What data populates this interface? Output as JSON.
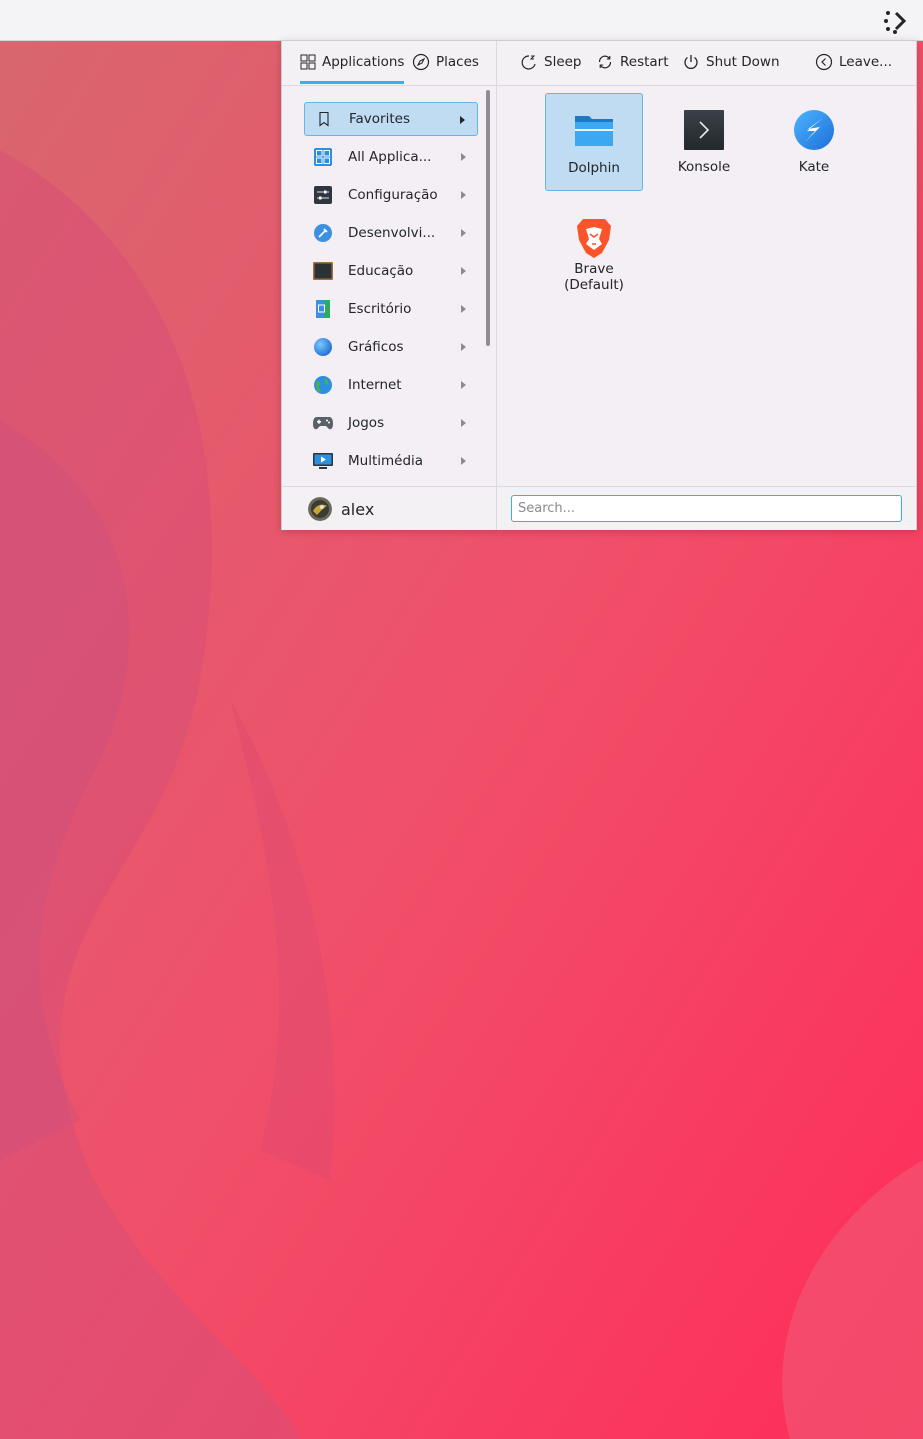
{
  "colors": {
    "accent": "#3daee9",
    "selection_bg": "#bfdcf2",
    "wallpaper_base": "#f2586d"
  },
  "header": {
    "tabs": [
      {
        "label": "Applications",
        "icon": "grid-icon",
        "active": true
      },
      {
        "label": "Places",
        "icon": "compass-icon",
        "active": false
      }
    ],
    "power": [
      {
        "label": "Sleep",
        "icon": "sleep-icon"
      },
      {
        "label": "Restart",
        "icon": "restart-icon"
      },
      {
        "label": "Shut Down",
        "icon": "power-icon"
      },
      {
        "label": "Leave...",
        "icon": "leave-icon"
      }
    ]
  },
  "categories": [
    {
      "label": "Favorites",
      "icon": "bookmark-icon",
      "selected": true
    },
    {
      "label": "All Applica...",
      "icon": "all-apps-icon"
    },
    {
      "label": "Configuração",
      "icon": "settings-icon"
    },
    {
      "label": "Desenvolvi...",
      "icon": "development-icon"
    },
    {
      "label": "Educação",
      "icon": "education-icon"
    },
    {
      "label": "Escritório",
      "icon": "office-icon"
    },
    {
      "label": "Gráficos",
      "icon": "graphics-icon"
    },
    {
      "label": "Internet",
      "icon": "internet-icon"
    },
    {
      "label": "Jogos",
      "icon": "games-icon"
    },
    {
      "label": "Multimédia",
      "icon": "multimedia-icon"
    }
  ],
  "favorites": [
    {
      "label": "Dolphin",
      "icon": "dolphin-folder-icon",
      "selected": true
    },
    {
      "label": "Konsole",
      "icon": "konsole-terminal-icon"
    },
    {
      "label": "Kate",
      "icon": "kate-editor-icon"
    },
    {
      "label": "Brave\n(Default)",
      "line1": "Brave",
      "line2": "(Default)",
      "icon": "brave-browser-icon"
    }
  ],
  "footer": {
    "user_name": "alex",
    "search_placeholder": "Search..."
  }
}
